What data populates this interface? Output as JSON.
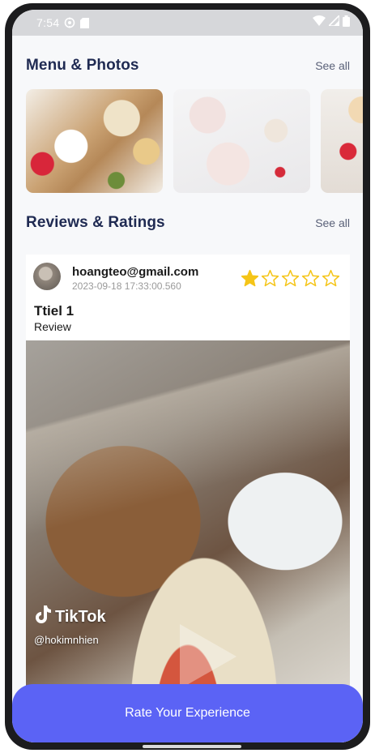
{
  "status_bar": {
    "time": "7:54",
    "icons": [
      "vpn-icon",
      "sd-card-icon",
      "wifi-icon",
      "signal-icon",
      "battery-icon"
    ]
  },
  "menu_photos": {
    "title": "Menu & Photos",
    "see_all": "See all"
  },
  "reviews": {
    "title": "Reviews & Ratings",
    "see_all": "See all",
    "items": [
      {
        "email": "hoangteo@gmail.com",
        "date": "2023-09-18 17:33:00.560",
        "rating": 1,
        "max_rating": 5,
        "title": "Ttiel 1",
        "text": "Review",
        "video": {
          "platform": "TikTok",
          "handle": "@hokimnhien"
        }
      }
    ]
  },
  "colors": {
    "accent": "#5b63f5",
    "title": "#1f2a52",
    "star": "#f5c518"
  },
  "cta": {
    "label": "Rate Your Experience"
  }
}
